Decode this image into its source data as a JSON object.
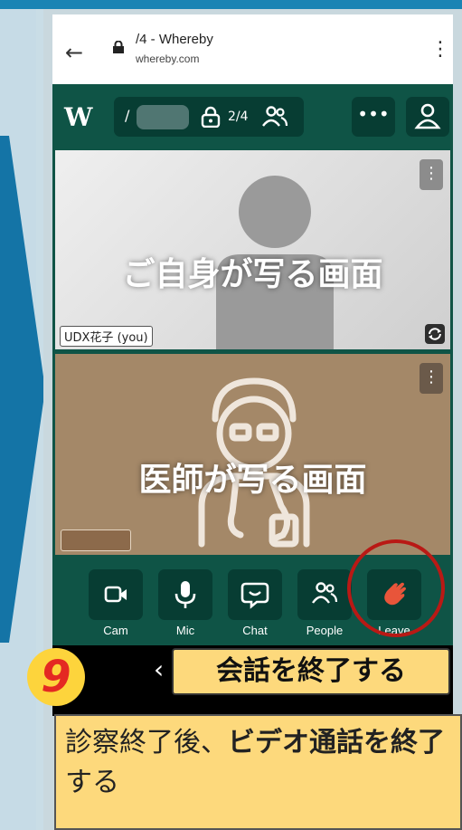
{
  "browser": {
    "url_title": "/4       - Whereby",
    "url_domain": "whereby.com"
  },
  "toolbar": {
    "room_prefix": "/",
    "participant_count": "2/4"
  },
  "tiles": {
    "self_caption": "ご自身が写る画面",
    "self_name": "UDX花子 (you)",
    "doctor_caption": "医師が写る画面"
  },
  "controls": {
    "cam": "Cam",
    "mic": "Mic",
    "chat": "Chat",
    "people": "People",
    "leave": "Leave"
  },
  "annotation": {
    "step_number": "9",
    "callout": "会話を終了する",
    "instruction_part1": "診察終了後、",
    "instruction_bold1": "ビデオ通話を終了",
    "instruction_part2": "する"
  },
  "colors": {
    "brand_green": "#0f5446",
    "dark_green": "#073d33",
    "highlight_yellow": "#fdd97c",
    "accent_red": "#b91915",
    "leave_orange": "#e8553a"
  }
}
